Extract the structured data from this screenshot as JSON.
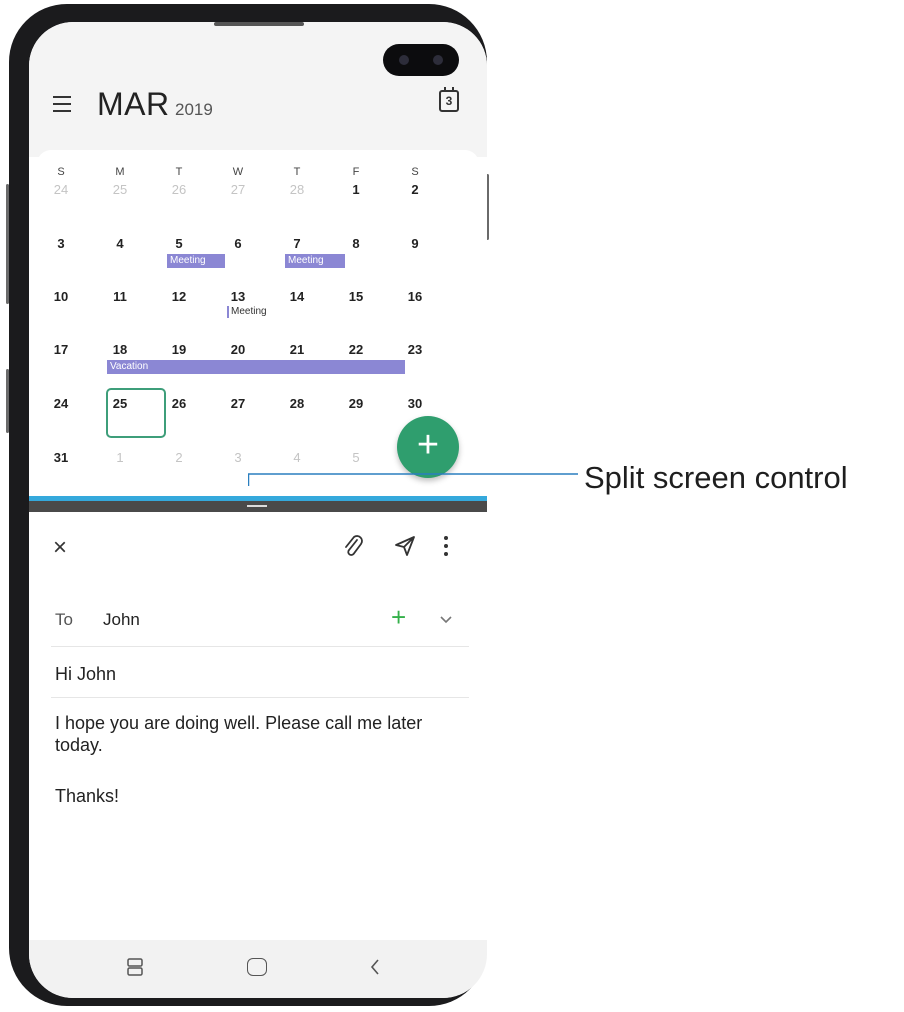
{
  "calendar": {
    "month": "MAR",
    "year": "2019",
    "today_icon_label": "3",
    "days_of_week": [
      "S",
      "M",
      "T",
      "W",
      "T",
      "F",
      "S"
    ],
    "weeks": [
      [
        "24",
        "25",
        "26",
        "27",
        "28",
        "1",
        "2"
      ],
      [
        "3",
        "4",
        "5",
        "6",
        "7",
        "8",
        "9"
      ],
      [
        "10",
        "11",
        "12",
        "13",
        "14",
        "15",
        "16"
      ],
      [
        "17",
        "18",
        "19",
        "20",
        "21",
        "22",
        "23"
      ],
      [
        "24",
        "25",
        "26",
        "27",
        "28",
        "29",
        "30"
      ],
      [
        "31",
        "1",
        "2",
        "3",
        "4",
        "5",
        ""
      ]
    ],
    "events": {
      "meeting_5": "Meeting",
      "meeting_7": "Meeting",
      "meeting_13": "Meeting",
      "vacation": "Vacation"
    },
    "selected_day": "25",
    "fab_label": "+"
  },
  "email": {
    "close_label": "×",
    "to_label": "To",
    "to_value": "John",
    "add_recipient_label": "+",
    "subject": "Hi John",
    "body": "I hope you are doing well. Please call me later today.",
    "signoff": "Thanks!"
  },
  "callout": {
    "label": "Split screen control"
  },
  "colors": {
    "event": "#8b87d4",
    "fab": "#2f9e6e",
    "split_bar": "#35a9dc",
    "add_recipient": "#34b04a",
    "selected_outline": "#3e9e7a"
  },
  "icons": {
    "menu": "hamburger-icon",
    "today": "calendar-today-icon",
    "close": "close-icon",
    "attach": "paperclip-icon",
    "send": "send-icon",
    "more": "more-vertical-icon",
    "expand": "chevron-down-icon",
    "recents": "recents-icon",
    "home": "home-icon",
    "back": "back-icon"
  }
}
